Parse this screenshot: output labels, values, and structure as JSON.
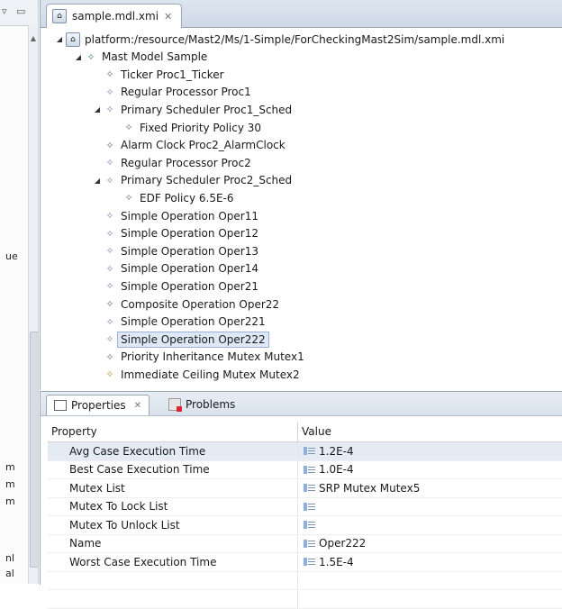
{
  "editor": {
    "tab_label": "sample.mdl.xmi",
    "tree": [
      {
        "label": "platform:/resource/Mast2/Ms/1-Simple/ForCheckingMast2Sim/sample.mdl.xmi",
        "level": 0,
        "expanded": true,
        "icon": "resource"
      },
      {
        "label": "Mast Model Sample",
        "level": 1,
        "expanded": true,
        "icon": "green"
      },
      {
        "label": "Ticker Proc1_Ticker",
        "level": 2,
        "icon": "dark"
      },
      {
        "label": "Regular Processor Proc1",
        "level": 2,
        "icon": "purple"
      },
      {
        "label": "Primary Scheduler Proc1_Sched",
        "level": 2,
        "expanded": true,
        "icon": "purple"
      },
      {
        "label": "Fixed Priority Policy 30",
        "level": 3,
        "icon": "dark"
      },
      {
        "label": "Alarm Clock Proc2_AlarmClock",
        "level": 2,
        "icon": "dark"
      },
      {
        "label": "Regular Processor Proc2",
        "level": 2,
        "icon": "purple"
      },
      {
        "label": "Primary Scheduler Proc2_Sched",
        "level": 2,
        "expanded": true,
        "icon": "purple"
      },
      {
        "label": "EDF Policy 6.5E-6",
        "level": 3,
        "icon": "dark"
      },
      {
        "label": "Simple Operation Oper11",
        "level": 2,
        "icon": "purple"
      },
      {
        "label": "Simple Operation Oper12",
        "level": 2,
        "icon": "purple"
      },
      {
        "label": "Simple Operation Oper13",
        "level": 2,
        "icon": "purple"
      },
      {
        "label": "Simple Operation Oper14",
        "level": 2,
        "icon": "purple"
      },
      {
        "label": "Simple Operation Oper21",
        "level": 2,
        "icon": "purple"
      },
      {
        "label": "Composite Operation Oper22",
        "level": 2,
        "icon": "dark"
      },
      {
        "label": "Simple Operation Oper221",
        "level": 2,
        "icon": "purple"
      },
      {
        "label": "Simple Operation Oper222",
        "level": 2,
        "icon": "purple",
        "selected": true
      },
      {
        "label": "Priority Inheritance Mutex Mutex1",
        "level": 2,
        "icon": "dark"
      },
      {
        "label": "Immediate Ceiling Mutex Mutex2",
        "level": 2,
        "icon": "gold"
      }
    ]
  },
  "properties": {
    "tab_properties": "Properties",
    "tab_problems": "Problems",
    "header_property": "Property",
    "header_value": "Value",
    "rows": [
      {
        "property": "Avg Case Execution Time",
        "value": "1.2E-4",
        "selected": true
      },
      {
        "property": "Best Case Execution Time",
        "value": "1.0E-4"
      },
      {
        "property": "Mutex List",
        "value": "SRP Mutex Mutex5"
      },
      {
        "property": "Mutex To Lock List",
        "value": ""
      },
      {
        "property": "Mutex To Unlock List",
        "value": ""
      },
      {
        "property": "Name",
        "value": "Oper222"
      },
      {
        "property": "Worst Case Execution Time",
        "value": "1.5E-4"
      }
    ]
  },
  "left_panel": {
    "fragments": [
      "ue",
      "m",
      "m",
      "m",
      "nl",
      "al"
    ]
  }
}
